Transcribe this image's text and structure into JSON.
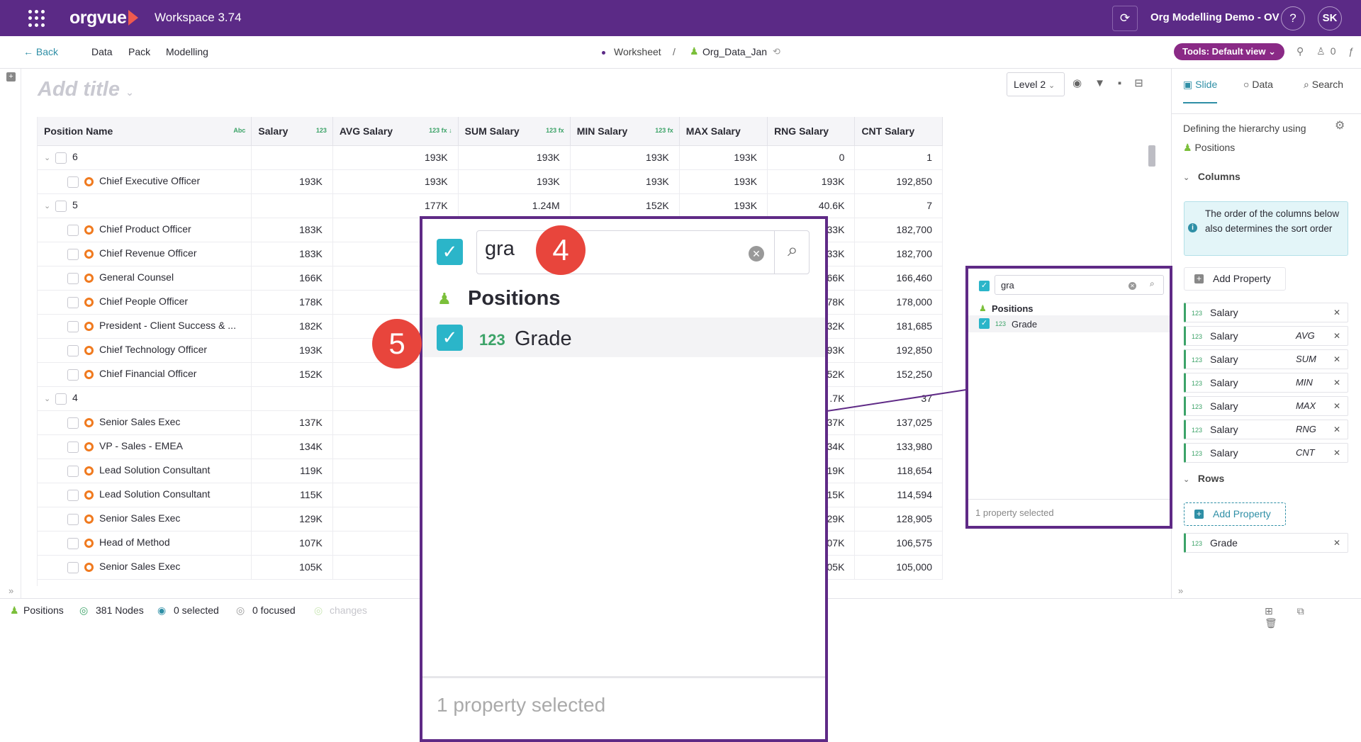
{
  "topbar": {
    "logo": "orgvue",
    "app_name": "Workspace  3.74",
    "org_name": "Org Modelling Demo - OV",
    "help": "?",
    "avatar": "SK"
  },
  "nav": {
    "back": "← Back",
    "items": [
      "Data",
      "Pack",
      "Modelling"
    ],
    "breadcrumb_worksheet": "Worksheet",
    "breadcrumb_sep": "/",
    "dataset": "Org_Data_Jan",
    "tools_button": "Tools: Default view ⌄"
  },
  "title_placeholder": "Add title",
  "level_select": "Level 2",
  "table": {
    "headers": [
      {
        "label": "Position Name",
        "tag": "Abc"
      },
      {
        "label": "Salary",
        "tag": "123"
      },
      {
        "label": "AVG Salary",
        "tag": "123 fx ↓"
      },
      {
        "label": "SUM Salary",
        "tag": "123 fx"
      },
      {
        "label": "MIN Salary",
        "tag": "123 fx"
      },
      {
        "label": "MAX Salary",
        "tag": ""
      },
      {
        "label": "RNG Salary",
        "tag": ""
      },
      {
        "label": "CNT Salary",
        "tag": ""
      }
    ],
    "rows": [
      {
        "level": "group",
        "name": "6",
        "salary": "",
        "avg": "193K",
        "sum": "193K",
        "min": "193K",
        "max": "193K",
        "rng": "0",
        "cnt": "1"
      },
      {
        "level": "leaf",
        "name": "Chief Executive Officer",
        "salary": "193K",
        "avg": "193K",
        "sum": "193K",
        "min": "193K",
        "max": "193K",
        "rng": "193K",
        "cnt": "192,850"
      },
      {
        "level": "group",
        "name": "5",
        "salary": "",
        "avg": "177K",
        "sum": "1.24M",
        "min": "152K",
        "max": "193K",
        "rng": "40.6K",
        "cnt": "7"
      },
      {
        "level": "leaf",
        "name": "Chief Product Officer",
        "salary": "183K",
        "avg": "",
        "sum": "",
        "min": "",
        "max": "",
        "rng": "33K",
        "cnt": "182,700"
      },
      {
        "level": "leaf",
        "name": "Chief Revenue Officer",
        "salary": "183K",
        "avg": "",
        "sum": "",
        "min": "",
        "max": "",
        "rng": "33K",
        "cnt": "182,700"
      },
      {
        "level": "leaf",
        "name": "General Counsel",
        "salary": "166K",
        "avg": "",
        "sum": "",
        "min": "",
        "max": "",
        "rng": "66K",
        "cnt": "166,460"
      },
      {
        "level": "leaf",
        "name": "Chief People Officer",
        "salary": "178K",
        "avg": "",
        "sum": "",
        "min": "",
        "max": "",
        "rng": "78K",
        "cnt": "178,000"
      },
      {
        "level": "leaf",
        "name": "President -  Client Success & ...",
        "salary": "182K",
        "avg": "",
        "sum": "",
        "min": "",
        "max": "",
        "rng": "32K",
        "cnt": "181,685"
      },
      {
        "level": "leaf",
        "name": "Chief Technology Officer",
        "salary": "193K",
        "avg": "",
        "sum": "",
        "min": "",
        "max": "",
        "rng": "93K",
        "cnt": "192,850"
      },
      {
        "level": "leaf",
        "name": "Chief Financial Officer",
        "salary": "152K",
        "avg": "",
        "sum": "",
        "min": "",
        "max": "",
        "rng": "52K",
        "cnt": "152,250"
      },
      {
        "level": "group",
        "name": "4",
        "salary": "",
        "avg": "",
        "sum": "",
        "min": "",
        "max": "",
        "rng": ".7K",
        "cnt": "37"
      },
      {
        "level": "leaf",
        "name": "Senior Sales Exec",
        "salary": "137K",
        "avg": "",
        "sum": "",
        "min": "",
        "max": "",
        "rng": "37K",
        "cnt": "137,025"
      },
      {
        "level": "leaf",
        "name": "VP - Sales - EMEA",
        "salary": "134K",
        "avg": "",
        "sum": "",
        "min": "",
        "max": "",
        "rng": "34K",
        "cnt": "133,980"
      },
      {
        "level": "leaf",
        "name": "Lead Solution Consultant",
        "salary": "119K",
        "avg": "",
        "sum": "",
        "min": "",
        "max": "",
        "rng": "19K",
        "cnt": "118,654"
      },
      {
        "level": "leaf",
        "name": "Lead Solution Consultant",
        "salary": "115K",
        "avg": "",
        "sum": "",
        "min": "",
        "max": "",
        "rng": "15K",
        "cnt": "114,594"
      },
      {
        "level": "leaf",
        "name": "Senior Sales Exec",
        "salary": "129K",
        "avg": "",
        "sum": "",
        "min": "",
        "max": "",
        "rng": "29K",
        "cnt": "128,905"
      },
      {
        "level": "leaf",
        "name": "Head of Method",
        "salary": "107K",
        "avg": "",
        "sum": "",
        "min": "",
        "max": "",
        "rng": "07K",
        "cnt": "106,575"
      },
      {
        "level": "leaf",
        "name": "Senior Sales Exec",
        "salary": "105K",
        "avg": "",
        "sum": "",
        "min": "",
        "max": "",
        "rng": "05K",
        "cnt": "105,000"
      }
    ]
  },
  "status": {
    "dataset": "Positions",
    "nodes": "381 Nodes",
    "selected": "0 selected",
    "focused": "0 focused",
    "changes": "changes"
  },
  "right_panel": {
    "tabs": [
      "Slide",
      "Data",
      "Search"
    ],
    "hierarchy_label": "Defining the hierarchy using",
    "hierarchy_value": "Positions",
    "columns_heading": "Columns",
    "info_text": "The order of the columns below also determines the sort order",
    "add_property": "Add Property",
    "columns": [
      {
        "tag": "123",
        "name": "Salary",
        "agg": ""
      },
      {
        "tag": "123",
        "name": "Salary",
        "agg": "AVG"
      },
      {
        "tag": "123",
        "name": "Salary",
        "agg": "SUM"
      },
      {
        "tag": "123",
        "name": "Salary",
        "agg": "MIN"
      },
      {
        "tag": "123",
        "name": "Salary",
        "agg": "MAX"
      },
      {
        "tag": "123",
        "name": "Salary",
        "agg": "RNG"
      },
      {
        "tag": "123",
        "name": "Salary",
        "agg": "CNT"
      }
    ],
    "rows_heading": "Rows",
    "rows": [
      {
        "tag": "123",
        "name": "Grade"
      }
    ]
  },
  "picker": {
    "search_value": "gra",
    "group": "Positions",
    "item_tag": "123",
    "item_name": "Grade",
    "footer": "1 property selected"
  },
  "callouts": {
    "step4": "4",
    "step5": "5"
  },
  "colors": {
    "brand": "#5b2a86",
    "accent": "#2bb5c9",
    "badge": "#e8453c",
    "node": "#f07a1f"
  }
}
